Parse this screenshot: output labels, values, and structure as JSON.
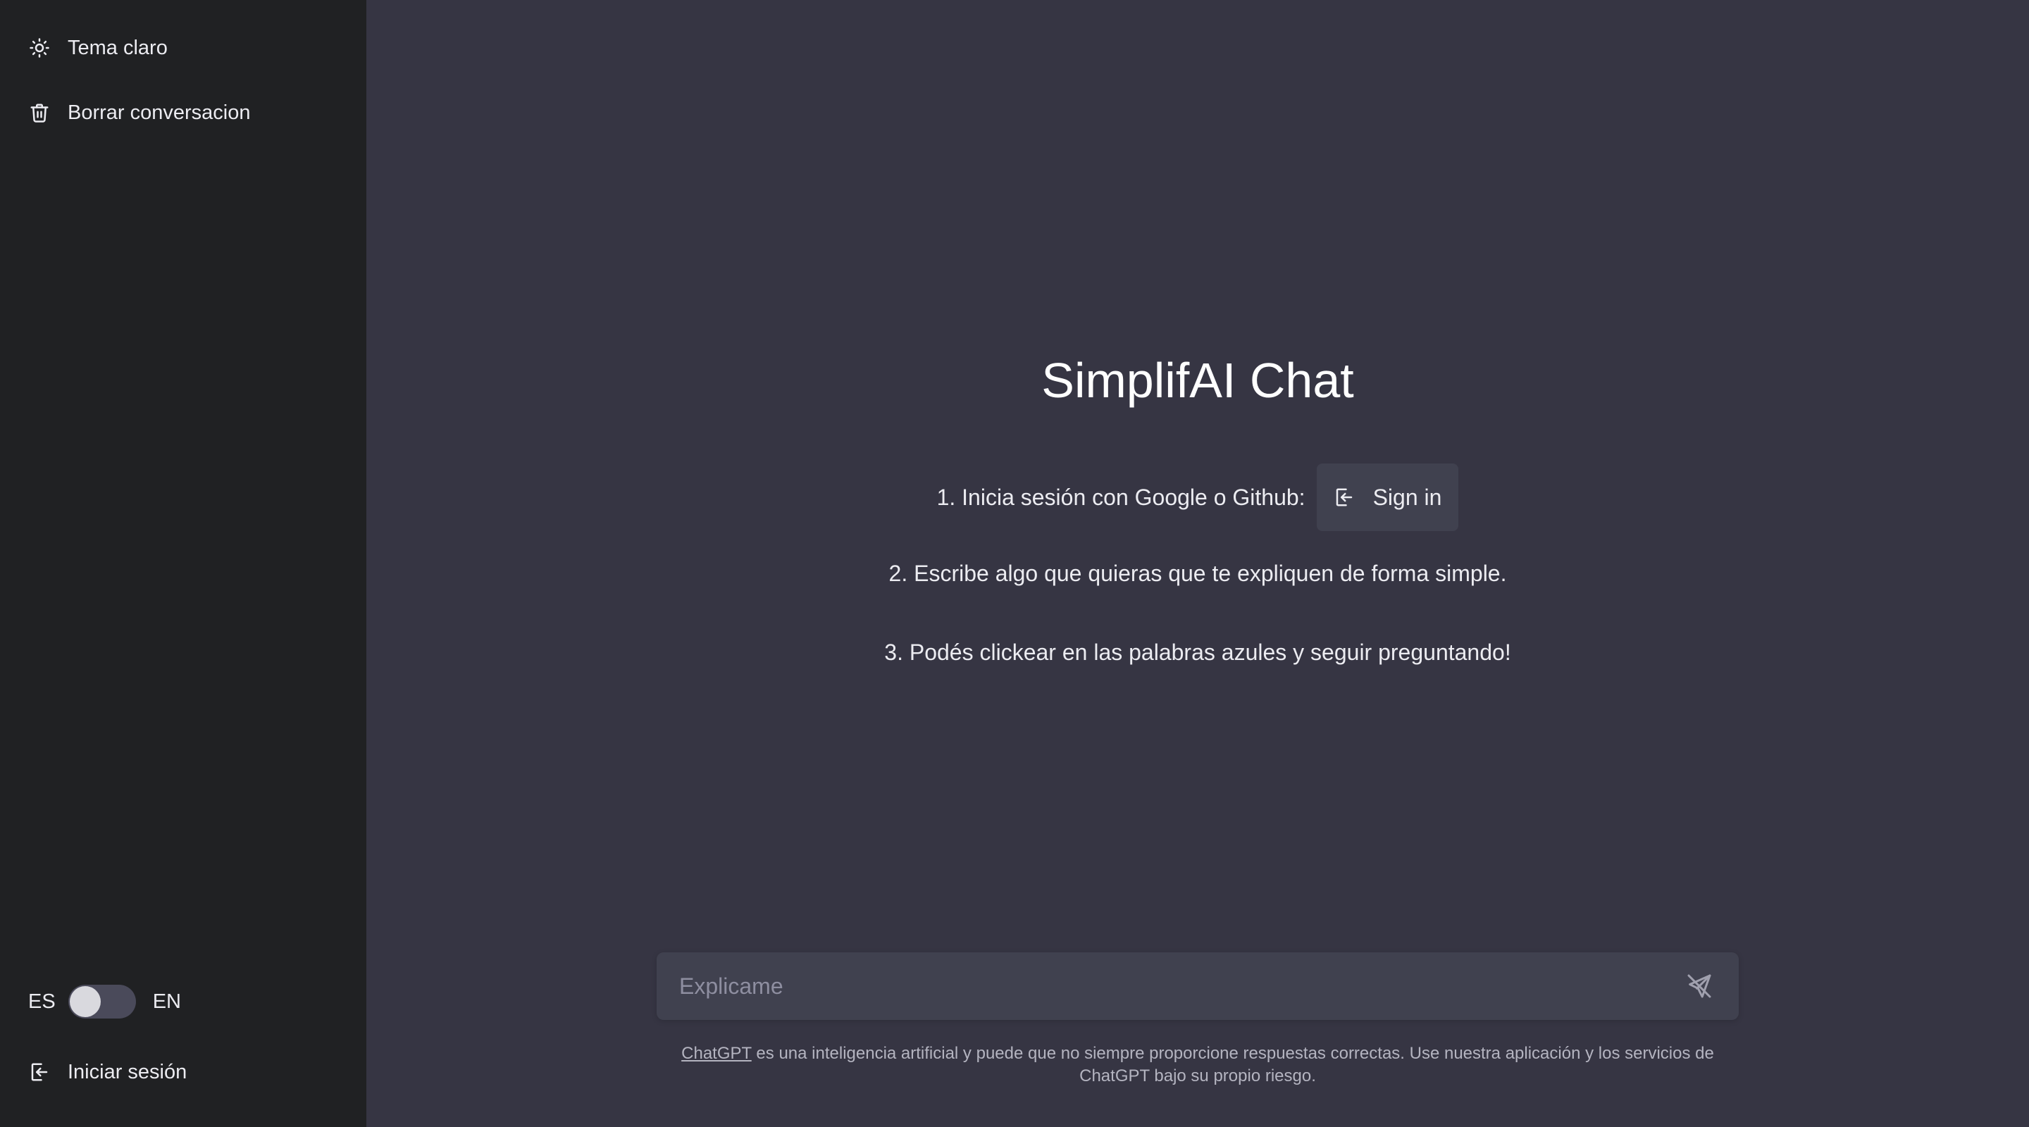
{
  "sidebar": {
    "items": [
      {
        "label": "Tema claro",
        "icon": "sun-icon"
      },
      {
        "label": "Borrar conversacion",
        "icon": "trash-icon"
      }
    ],
    "language": {
      "left": "ES",
      "right": "EN",
      "selected": "ES"
    },
    "login": {
      "label": "Iniciar sesión",
      "icon": "login-icon"
    }
  },
  "main": {
    "title": "SimplifAI Chat",
    "steps": {
      "step1": "1. Inicia sesión con Google o Github:",
      "signin_label": "Sign in",
      "step2": "2. Escribe algo que quieras que te expliquen de forma simple.",
      "step3": "3. Podés clickear en las palabras azules y seguir preguntando!"
    },
    "input": {
      "placeholder": "Explicame",
      "value": ""
    },
    "disclaimer": {
      "link": "ChatGPT",
      "text": " es una inteligencia artificial y puede que no siempre proporcione respuestas correctas. Use nuestra aplicación y los servicios de ChatGPT bajo su propio riesgo."
    }
  },
  "colors": {
    "sidebar_bg": "#202123",
    "main_bg": "#363543",
    "input_bg": "#40414f",
    "text": "#ececf1"
  }
}
